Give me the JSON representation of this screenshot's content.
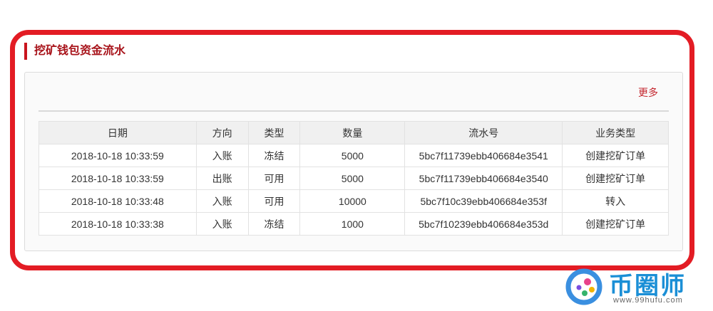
{
  "section": {
    "title": "挖矿钱包资金流水",
    "more_link": "更多"
  },
  "table": {
    "headers": [
      "日期",
      "方向",
      "类型",
      "数量",
      "流水号",
      "业务类型"
    ],
    "rows": [
      [
        "2018-10-18 10:33:59",
        "入账",
        "冻结",
        "5000",
        "5bc7f11739ebb406684e3541",
        "创建挖矿订单"
      ],
      [
        "2018-10-18 10:33:59",
        "出账",
        "可用",
        "5000",
        "5bc7f11739ebb406684e3540",
        "创建挖矿订单"
      ],
      [
        "2018-10-18 10:33:48",
        "入账",
        "可用",
        "10000",
        "5bc7f10c39ebb406684e353f",
        "转入"
      ],
      [
        "2018-10-18 10:33:38",
        "入账",
        "冻结",
        "1000",
        "5bc7f10239ebb406684e353d",
        "创建挖矿订单"
      ]
    ]
  },
  "watermark": {
    "brand": "币圈师",
    "url": "www.99hufu.com"
  },
  "colors": {
    "highlight_border": "#e31c24",
    "title": "#a8141b",
    "link": "#c4262e",
    "brand": "#1b8fd6"
  }
}
